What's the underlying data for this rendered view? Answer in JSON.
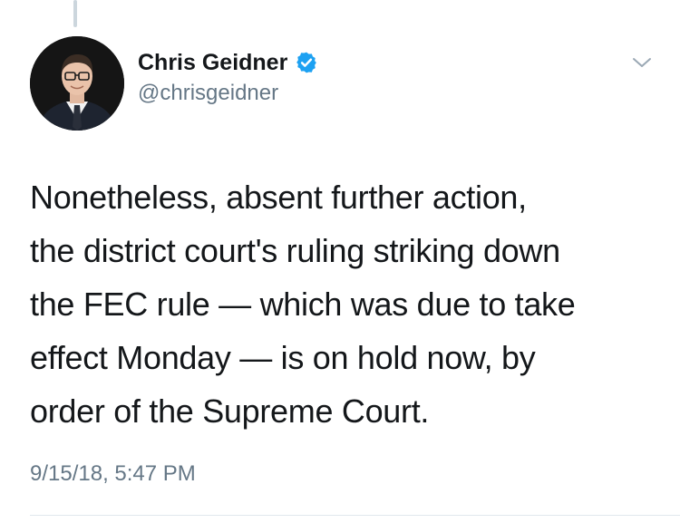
{
  "author": {
    "display_name": "Chris Geidner",
    "handle": "@chrisgeidner",
    "verified": true
  },
  "tweet": {
    "text": "Nonetheless, absent further action,\nthe district court's ruling striking down\nthe FEC rule — which was due to take\neffect Monday — is on hold now, by\norder of the Supreme Court.",
    "timestamp": "9/15/18, 5:47 PM"
  },
  "icons": {
    "verified": "verified-badge-icon",
    "menu": "chevron-down-icon"
  },
  "colors": {
    "verified_blue": "#1da1f2",
    "secondary_text": "#657786",
    "primary_text": "#14171a"
  }
}
